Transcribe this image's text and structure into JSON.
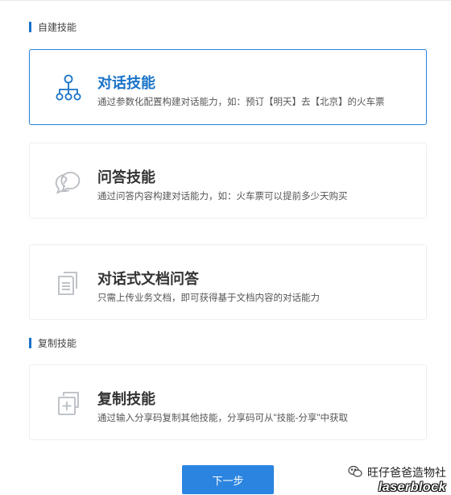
{
  "sections": {
    "custom": {
      "title": "自建技能"
    },
    "copy": {
      "title": "复制技能"
    }
  },
  "cards": [
    {
      "title": "对话技能",
      "desc": "通过参数化配置构建对话能力，如：预订【明天】去【北京】的火车票",
      "icon": "hierarchy-icon",
      "selected": true
    },
    {
      "title": "问答技能",
      "desc": "通过问答内容构建对话能力，如：火车票可以提前多少天购买",
      "icon": "qa-bubble-icon",
      "selected": false
    },
    {
      "title": "对话式文档问答",
      "desc": "只需上传业务文档，即可获得基于文档内容的对话能力",
      "icon": "document-icon",
      "selected": false
    },
    {
      "title": "复制技能",
      "desc": "通过输入分享码复制其他技能，分享码可从\"技能-分享\"中获取",
      "icon": "copy-add-icon",
      "selected": false
    }
  ],
  "next_button": {
    "label": "下一步"
  },
  "watermark": {
    "line1": "旺仔爸爸造物社",
    "line2": "laserblock"
  },
  "colors": {
    "accent": "#1a73c8",
    "button": "#2b84e0",
    "icon_gray": "#b8bcc2"
  }
}
